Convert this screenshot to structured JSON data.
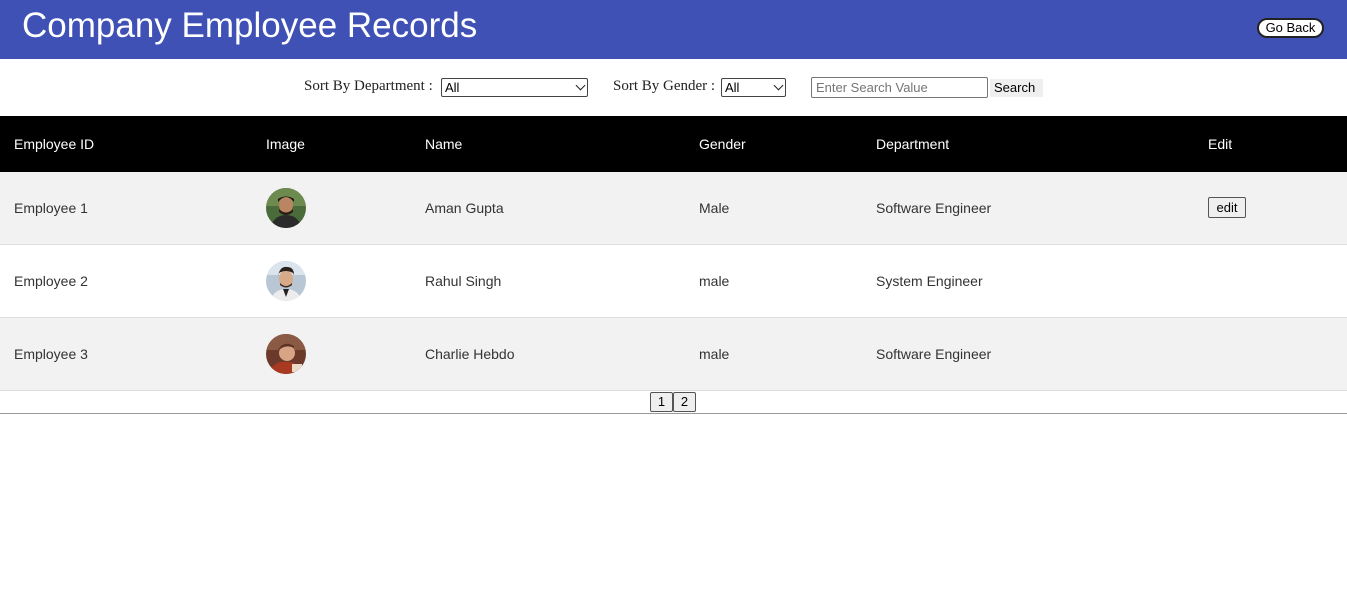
{
  "header": {
    "title": "Company Employee Records",
    "back_label": "Go Back"
  },
  "colors": {
    "header_bg": "#3f51b5",
    "table_head_bg": "#000000",
    "row_alt_bg": "#f2f2f2"
  },
  "filters": {
    "department_label": "Sort By Department :",
    "department_value": "All",
    "gender_label": "Sort By Gender :",
    "gender_value": "All",
    "search_placeholder": "Enter Search Value",
    "search_value": "",
    "search_label": "Search"
  },
  "table": {
    "columns": [
      "Employee ID",
      "Image",
      "Name",
      "Gender",
      "Department",
      "Edit"
    ],
    "rows": [
      {
        "id": "Employee 1",
        "image": "avatar-aman",
        "name": "Aman Gupta",
        "gender": "Male",
        "department": "Software Engineer",
        "edit_label": "edit"
      },
      {
        "id": "Employee 2",
        "image": "avatar-rahul",
        "name": "Rahul Singh",
        "gender": "male",
        "department": "System Engineer",
        "edit_label": ""
      },
      {
        "id": "Employee 3",
        "image": "avatar-charlie",
        "name": "Charlie Hebdo",
        "gender": "male",
        "department": "Software Engineer",
        "edit_label": ""
      }
    ]
  },
  "pagination": {
    "pages": [
      "1",
      "2"
    ]
  }
}
